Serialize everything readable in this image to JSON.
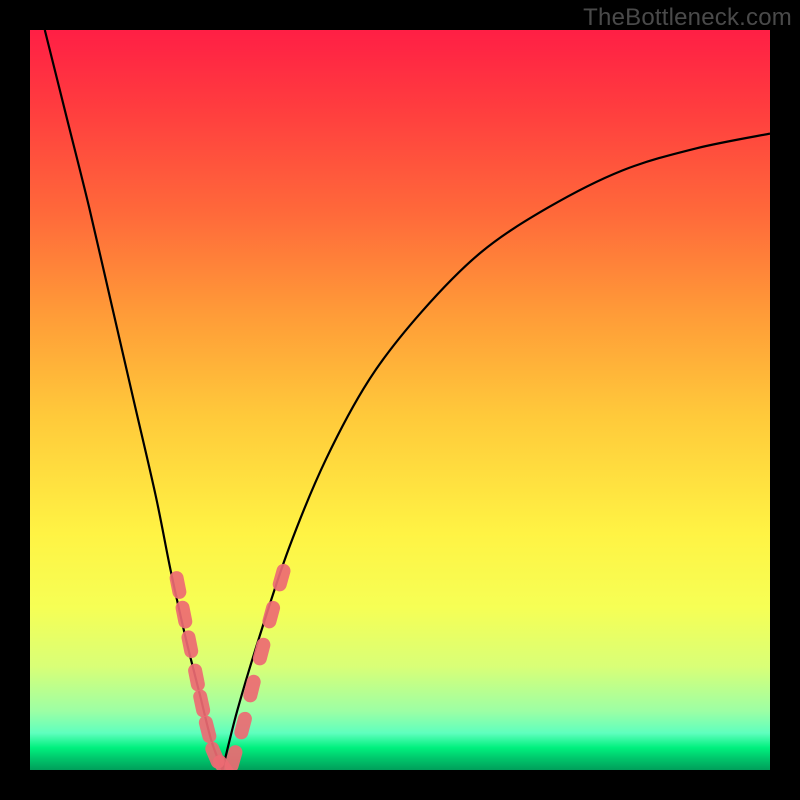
{
  "watermark": "TheBottleneck.com",
  "colors": {
    "background": "#000000",
    "marker": "#ed6a73",
    "curve": "#000000"
  },
  "chart_data": {
    "type": "line",
    "title": "",
    "xlabel": "",
    "ylabel": "",
    "xlim": [
      0,
      100
    ],
    "ylim": [
      0,
      100
    ],
    "grid": false,
    "series": [
      {
        "name": "left-curve",
        "x": [
          2,
          5,
          8,
          11,
          14,
          17,
          19,
          21,
          23,
          24.5,
          26
        ],
        "y": [
          100,
          88,
          76,
          63,
          50,
          37,
          27,
          18,
          10,
          4,
          0
        ]
      },
      {
        "name": "right-curve",
        "x": [
          26,
          28,
          31,
          35,
          40,
          46,
          53,
          61,
          70,
          80,
          90,
          100
        ],
        "y": [
          0,
          8,
          18,
          30,
          42,
          53,
          62,
          70,
          76,
          81,
          84,
          86
        ]
      }
    ],
    "markers_left": [
      {
        "x": 20.0,
        "y": 25.0
      },
      {
        "x": 20.8,
        "y": 21.0
      },
      {
        "x": 21.6,
        "y": 17.0
      },
      {
        "x": 22.5,
        "y": 12.5
      },
      {
        "x": 23.2,
        "y": 9.0
      },
      {
        "x": 24.0,
        "y": 5.5
      },
      {
        "x": 25.0,
        "y": 2.0
      },
      {
        "x": 26.2,
        "y": 0.3
      }
    ],
    "markers_right": [
      {
        "x": 27.5,
        "y": 1.5
      },
      {
        "x": 28.8,
        "y": 6.0
      },
      {
        "x": 30.0,
        "y": 11.0
      },
      {
        "x": 31.3,
        "y": 16.0
      },
      {
        "x": 32.6,
        "y": 21.0
      },
      {
        "x": 34.0,
        "y": 26.0
      }
    ]
  }
}
